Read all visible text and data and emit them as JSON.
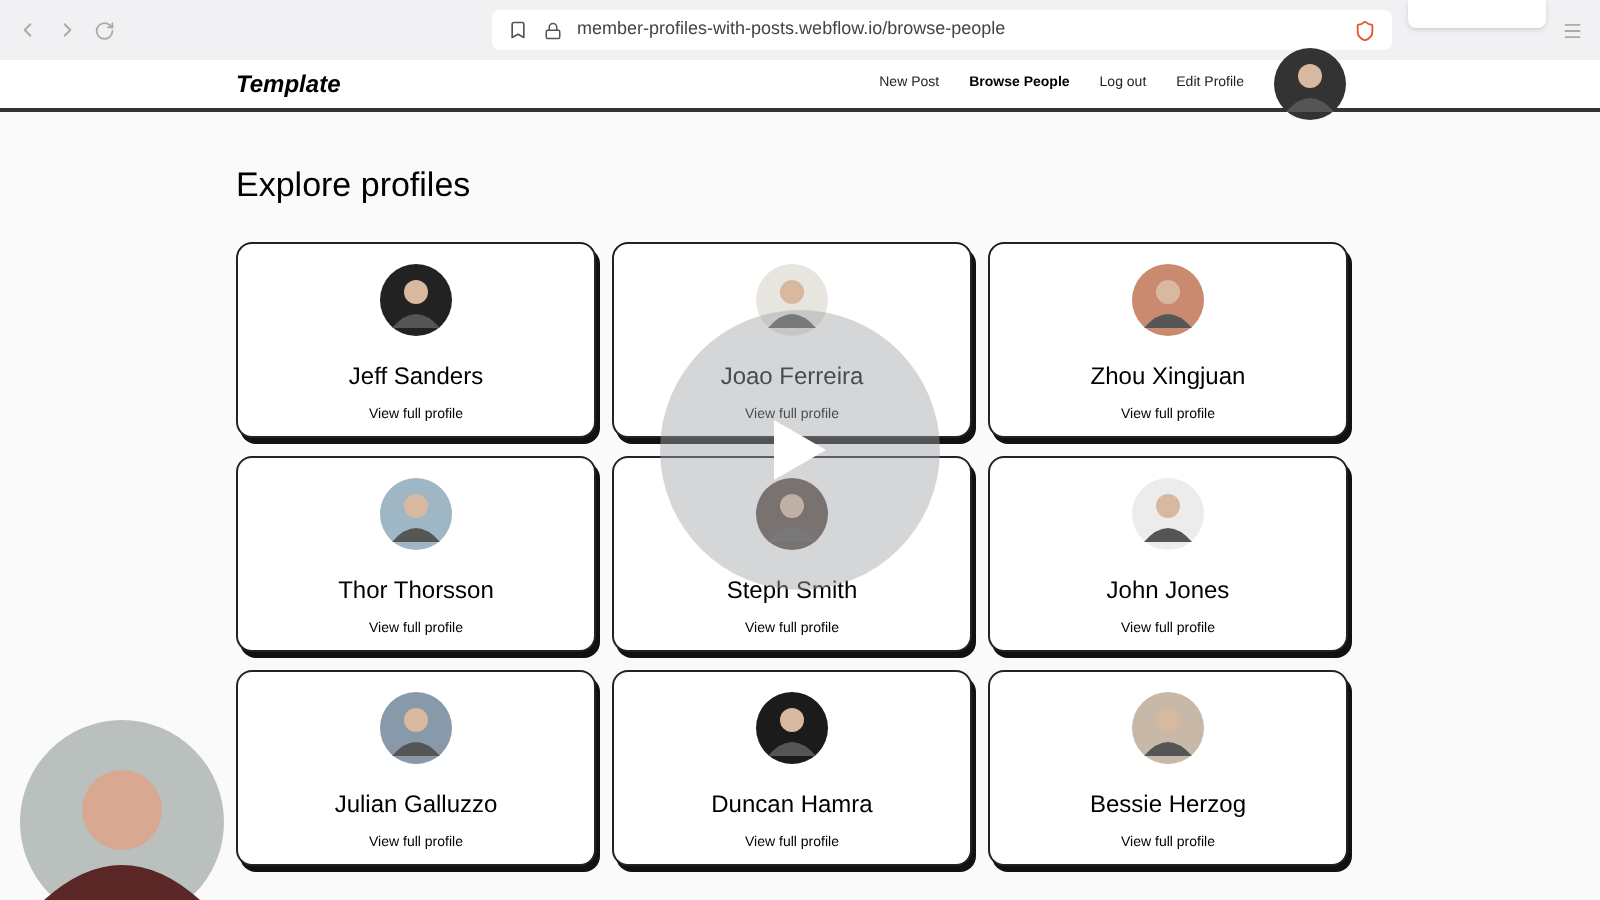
{
  "browser": {
    "url": "member-profiles-with-posts.webflow.io/browse-people"
  },
  "nav": {
    "logo": "Template",
    "links": [
      {
        "label": "New Post",
        "selected": false
      },
      {
        "label": "Browse People",
        "selected": true
      },
      {
        "label": "Log out",
        "selected": false
      },
      {
        "label": "Edit Profile",
        "selected": false
      }
    ]
  },
  "page": {
    "title": "Explore profiles"
  },
  "profiles": [
    {
      "name": "Jeff Sanders",
      "link": "View full profile"
    },
    {
      "name": "Joao Ferreira",
      "link": "View full profile"
    },
    {
      "name": "Zhou Xingjuan",
      "link": "View full profile"
    },
    {
      "name": "Thor Thorsson",
      "link": "View full profile"
    },
    {
      "name": "Steph Smith",
      "link": "View full profile"
    },
    {
      "name": "John Jones",
      "link": "View full profile"
    },
    {
      "name": "Julian Galluzzo",
      "link": "View full profile"
    },
    {
      "name": "Duncan Hamra",
      "link": "View full profile"
    },
    {
      "name": "Bessie Herzog",
      "link": "View full profile"
    }
  ]
}
